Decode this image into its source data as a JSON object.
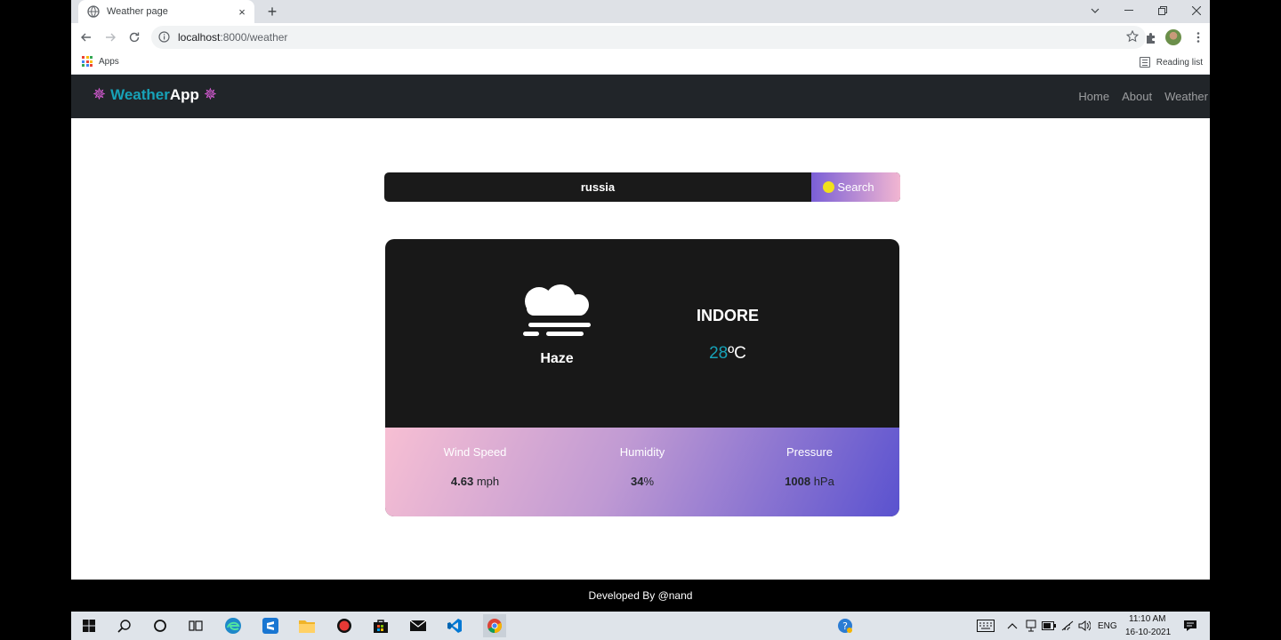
{
  "browser": {
    "tab_title": "Weather page",
    "tab_close": "×",
    "new_tab": "+",
    "url_host": "localhost",
    "url_path": ":8000/weather",
    "bookmarks_apps": "Apps",
    "reading_list": "Reading list"
  },
  "navbar": {
    "brand_part1": "Weather",
    "brand_part2": "App",
    "links": [
      "Home",
      "About",
      "Weather"
    ]
  },
  "search": {
    "value": "russia",
    "button": "Search"
  },
  "weather": {
    "condition": "Haze",
    "city": "INDORE",
    "temp": "28",
    "temp_unit": "ºC",
    "stats": [
      {
        "label": "Wind Speed",
        "value": "4.63",
        "unit": "mph"
      },
      {
        "label": "Humidity",
        "value": "34",
        "unit": "%"
      },
      {
        "label": "Pressure",
        "value": "1008",
        "unit": "hPa"
      }
    ]
  },
  "footer": "Developed By @nand",
  "taskbar": {
    "language": "ENG",
    "time": "11:10 AM",
    "date": "16-10-2021"
  }
}
